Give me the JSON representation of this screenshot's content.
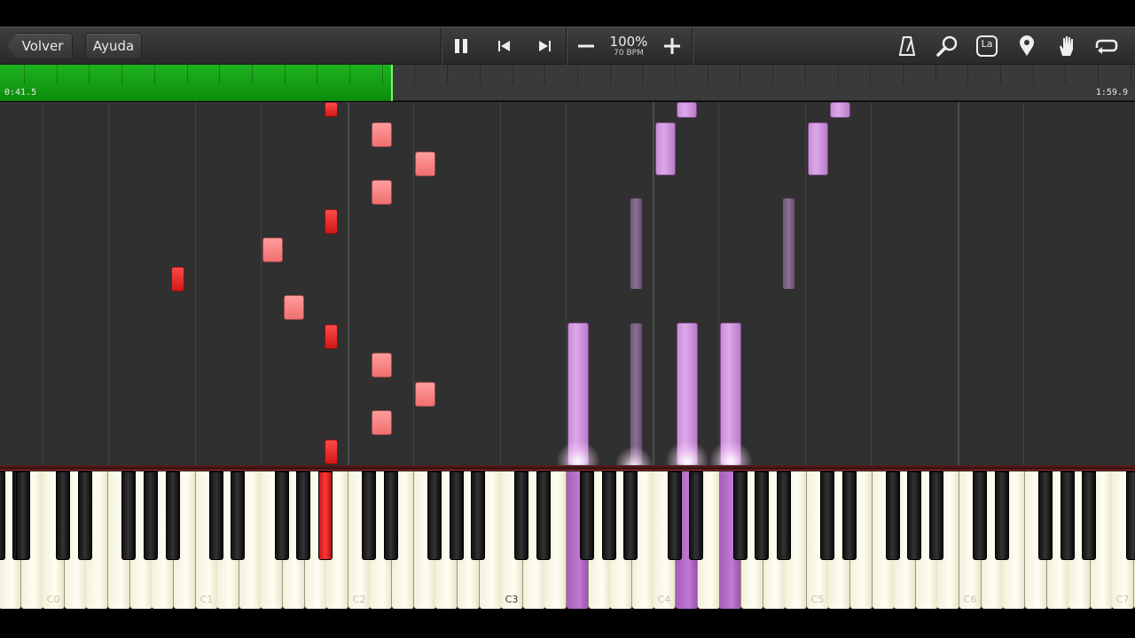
{
  "toolbar": {
    "back_label": "Volver",
    "help_label": "Ayuda",
    "tempo_percent": "100%",
    "tempo_bpm": "70 BPM",
    "key_label": "La",
    "icons": [
      "pause-icon",
      "previous-icon",
      "next-icon",
      "minus-icon",
      "plus-icon",
      "metronome-icon",
      "search-icon",
      "key-icon",
      "pin-icon",
      "hand-icon",
      "loop-icon"
    ]
  },
  "progress": {
    "elapsed": "0:41.5",
    "total": "1:59.9",
    "fraction": 0.346,
    "color": "#12a012"
  },
  "keyboard": {
    "octave_labels": [
      "C0",
      "C1",
      "C2",
      "C3",
      "C4",
      "C5",
      "C6",
      "C7"
    ],
    "highlighted_label": "C3",
    "right_hand_color": "#ff8080",
    "left_hand_color": "#c98fd9"
  }
}
